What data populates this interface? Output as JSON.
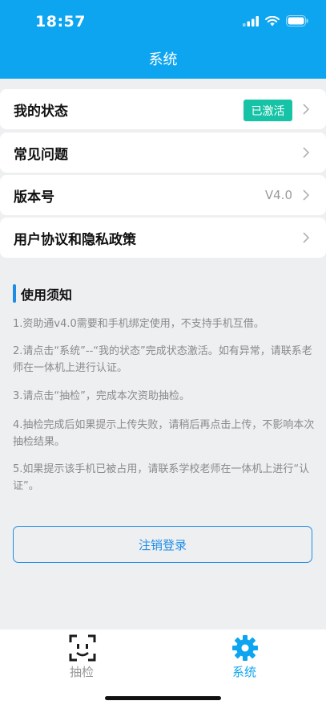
{
  "status_bar": {
    "time": "18:57"
  },
  "header": {
    "title": "系统"
  },
  "menu": {
    "items": [
      {
        "label": "我的状态",
        "badge": "已激活"
      },
      {
        "label": "常见问题"
      },
      {
        "label": "版本号",
        "value": "V4.0"
      },
      {
        "label": "用户协议和隐私政策"
      }
    ]
  },
  "notice": {
    "title": "使用须知",
    "items": [
      "1.资助通v4.0需要和手机绑定使用，不支持手机互借。",
      "2.请点击“系统”--“我的状态”完成状态激活。如有异常，请联系老师在一体机上进行认证。",
      "3.请点击“抽检”，完成本次资助抽检。",
      "4.抽检完成后如果提示上传失败，请稍后再点击上传，不影响本次抽检结果。",
      "5.如果提示该手机已被占用，请联系学校老师在一体机上进行“认证”。"
    ]
  },
  "logout": {
    "label": "注销登录"
  },
  "tabbar": {
    "tabs": [
      {
        "label": "抽检",
        "icon": "face-scan-icon",
        "active": false
      },
      {
        "label": "系统",
        "icon": "gear-icon",
        "active": true
      }
    ]
  },
  "colors": {
    "header": "#0ea5f0",
    "accent": "#1e8de8",
    "badge": "#17c3a6"
  }
}
